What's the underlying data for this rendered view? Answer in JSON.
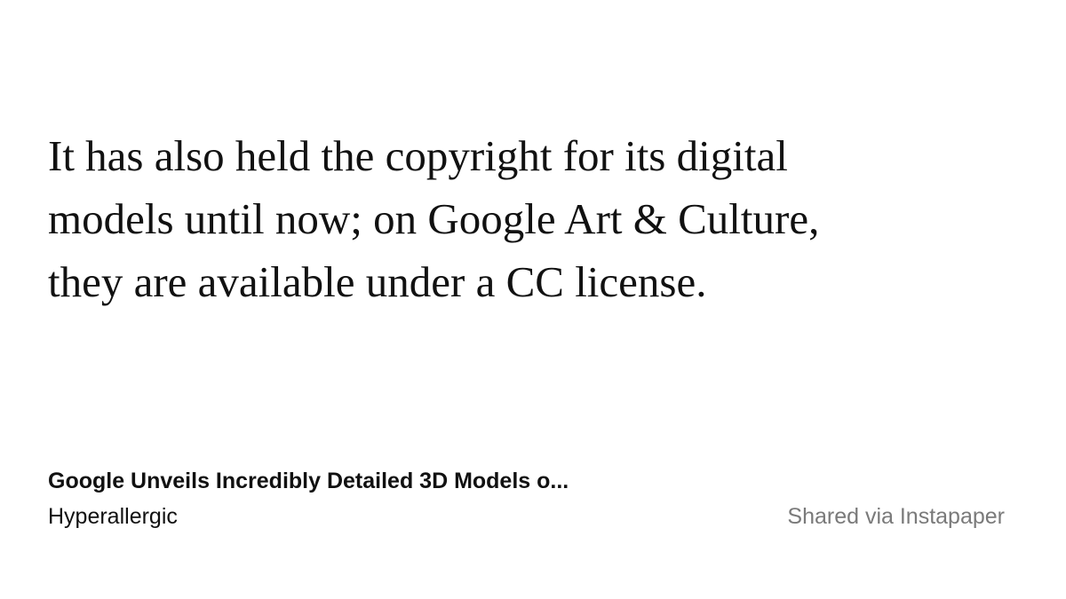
{
  "quote": {
    "lines": [
      "It has also held the copyright for its digital",
      "models until now; on Google Art & Culture,",
      "they are available under a CC license."
    ]
  },
  "article": {
    "title": "Google Unveils Incredibly Detailed 3D Models o...",
    "source": "Hyperallergic"
  },
  "attribution": {
    "text": "Shared via Instapaper"
  },
  "colors": {
    "background": "#ffffff",
    "text": "#111111",
    "muted": "#7a7a7a"
  }
}
